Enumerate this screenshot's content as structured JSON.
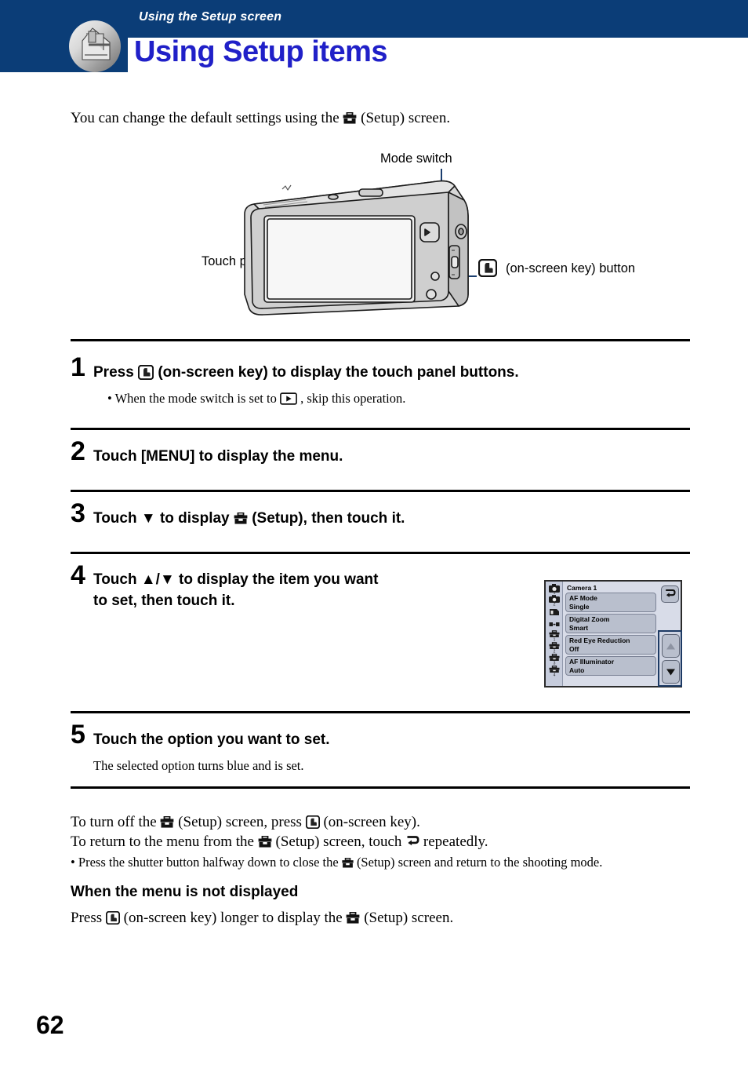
{
  "header": {
    "subtitle": "Using the Setup screen",
    "title": "Using Setup items",
    "navy_color": "#0b3d77",
    "title_color": "#2020c8",
    "icon": "camera-corner-icon"
  },
  "intro": {
    "before_icon": "You can change the default settings using the",
    "icon": "setup-toolbox-icon",
    "after_icon": "(Setup) screen."
  },
  "diagram": {
    "labels": {
      "mode_switch": "Mode switch",
      "touch_panel": "Touch panel",
      "on_screen_key": "(on-screen key) button"
    },
    "on_screen_key_icon": "on-screen-key-icon",
    "camera_illustration": "compact-camera-rear-view"
  },
  "steps": [
    {
      "number": "1",
      "head_before_icon": "Press",
      "head_icon": "on-screen-key-icon",
      "head_after_icon": "(on-screen key) to display the touch panel buttons.",
      "note_bullet": "•",
      "note_before_icon": "When the mode switch is set to",
      "note_icon": "playback-icon",
      "note_after_icon": ", skip this operation."
    },
    {
      "number": "2",
      "head_before_icon": "Touch [MENU] to display the menu.",
      "head_icon": "",
      "head_after_icon": ""
    },
    {
      "number": "3",
      "head_before_icon": "Touch ▼ to display",
      "head_icon": "setup-toolbox-icon",
      "head_after_icon": "(Setup), then touch it."
    },
    {
      "number": "4",
      "head_line1": "Touch ▲/▼ to display the item you want",
      "head_line2": "to set, then touch it."
    },
    {
      "number": "5",
      "head_before_icon": "Touch the option you want to set.",
      "note": "The selected option turns blue and is set."
    }
  ],
  "menu_screenshot": {
    "title": "Camera 1",
    "rail_icons": [
      "camera-1-icon",
      "camera-2-icon",
      "memory-card-icon",
      "internal-memory-icon",
      "setup-1-icon",
      "setup-2-icon",
      "setup-3-icon",
      "setup-4-icon"
    ],
    "items": [
      {
        "label": "AF Mode",
        "value": "Single"
      },
      {
        "label": "Digital Zoom",
        "value": "Smart"
      },
      {
        "label": "Red Eye Reduction",
        "value": "Off"
      },
      {
        "label": "AF Illuminator",
        "value": "Auto"
      }
    ],
    "return_button_icon": "return-arrow-icon",
    "scroll_up_icon": "triangle-up-icon",
    "scroll_down_icon": "triangle-down-icon",
    "highlight_color": "#1d3a64"
  },
  "closing": {
    "line1_a": "To turn off the",
    "line1_icon1": "setup-toolbox-icon",
    "line1_b": "(Setup) screen, press",
    "line1_icon2": "on-screen-key-icon",
    "line1_c": "(on-screen key).",
    "line2_a": "To return to the menu from the",
    "line2_icon1": "setup-toolbox-icon",
    "line2_b": "(Setup) screen, touch",
    "line2_icon2": "return-arrow-icon",
    "line2_c": "repeatedly.",
    "line3_bullet": "•",
    "line3_a": "Press the shutter button halfway down to close the",
    "line3_icon": "setup-toolbox-icon",
    "line3_b": "(Setup) screen and return to the shooting mode."
  },
  "section": {
    "heading": "When the menu is not displayed",
    "body_a": "Press",
    "body_icon1": "on-screen-key-icon",
    "body_b": "(on-screen key) longer to display the",
    "body_icon2": "setup-toolbox-icon",
    "body_c": "(Setup) screen."
  },
  "page_number": "62"
}
